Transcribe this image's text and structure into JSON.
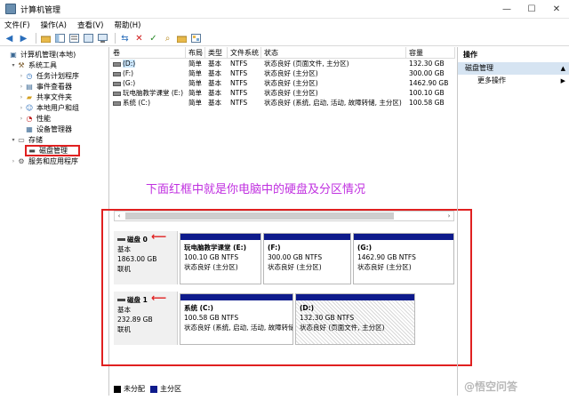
{
  "window": {
    "title": "计算机管理",
    "min": "—",
    "max": "☐",
    "close": "✕"
  },
  "menu": [
    "文件(F)",
    "操作(A)",
    "查看(V)",
    "帮助(H)"
  ],
  "tree": [
    {
      "label": "计算机管理(本地)",
      "indent": 0,
      "exp": "",
      "icon": "computer-icon"
    },
    {
      "label": "系统工具",
      "indent": 1,
      "exp": "▾",
      "icon": "tools-icon"
    },
    {
      "label": "任务计划程序",
      "indent": 2,
      "exp": "›",
      "icon": "clock-icon"
    },
    {
      "label": "事件查看器",
      "indent": 2,
      "exp": "›",
      "icon": "event-log-icon"
    },
    {
      "label": "共享文件夹",
      "indent": 2,
      "exp": "›",
      "icon": "folder-icon"
    },
    {
      "label": "本地用户和组",
      "indent": 2,
      "exp": "›",
      "icon": "users-icon"
    },
    {
      "label": "性能",
      "indent": 2,
      "exp": "›",
      "icon": "performance-icon"
    },
    {
      "label": "设备管理器",
      "indent": 2,
      "exp": "",
      "icon": "device-icon"
    },
    {
      "label": "存储",
      "indent": 1,
      "exp": "▾",
      "icon": "storage-icon"
    },
    {
      "label": "磁盘管理",
      "indent": 2,
      "exp": "",
      "icon": "disk-icon"
    },
    {
      "label": "服务和应用程序",
      "indent": 1,
      "exp": "›",
      "icon": "services-icon"
    }
  ],
  "volumes": {
    "headers": [
      "卷",
      "布局",
      "类型",
      "文件系统",
      "状态",
      "容量"
    ],
    "rows": [
      [
        "(D:)",
        "简单",
        "基本",
        "NTFS",
        "状态良好 (页面文件, 主分区)",
        "132.30 GB"
      ],
      [
        "(F:)",
        "简单",
        "基本",
        "NTFS",
        "状态良好 (主分区)",
        "300.00 GB"
      ],
      [
        "(G:)",
        "简单",
        "基本",
        "NTFS",
        "状态良好 (主分区)",
        "1462.90 GB"
      ],
      [
        "玩电脑教学课堂 (E:)",
        "简单",
        "基本",
        "NTFS",
        "状态良好 (主分区)",
        "100.10 GB"
      ],
      [
        "系统 (C:)",
        "简单",
        "基本",
        "NTFS",
        "状态良好 (系统, 启动, 活动, 故障转储, 主分区)",
        "100.58 GB"
      ]
    ]
  },
  "note": "下面红框中就是你电脑中的硬盘及分区情况",
  "disks": [
    {
      "name": "磁盘 0",
      "type": "基本",
      "size": "1863.00 GB",
      "status": "联机",
      "partitions": [
        {
          "name": "玩电脑教学课堂 (E:)",
          "size": "100.10 GB NTFS",
          "status": "状态良好 (主分区)"
        },
        {
          "name": "(F:)",
          "size": "300.00 GB NTFS",
          "status": "状态良好 (主分区)"
        },
        {
          "name": "(G:)",
          "size": "1462.90 GB NTFS",
          "status": "状态良好 (主分区)"
        }
      ]
    },
    {
      "name": "磁盘 1",
      "type": "基本",
      "size": "232.89 GB",
      "status": "联机",
      "partitions": [
        {
          "name": "系统 (C:)",
          "size": "100.58 GB NTFS",
          "status": "状态良好 (系统, 启动, 活动, 故障转储"
        },
        {
          "name": "(D:)",
          "size": "132.30 GB NTFS",
          "status": "状态良好 (页面文件, 主分区)"
        }
      ]
    }
  ],
  "legend": {
    "unallocated": "未分配",
    "primary": "主分区",
    "colors": {
      "unallocated": "#000000",
      "primary": "#0e1b8c"
    }
  },
  "actions": {
    "title": "操作",
    "section": "磁盘管理",
    "more": "更多操作"
  },
  "watermark": "@悟空问答",
  "colors": {
    "accent": "#0e1b8c",
    "highlight_red": "#e02020",
    "note_purple": "#c030e0",
    "selection": "#cce8ff"
  }
}
